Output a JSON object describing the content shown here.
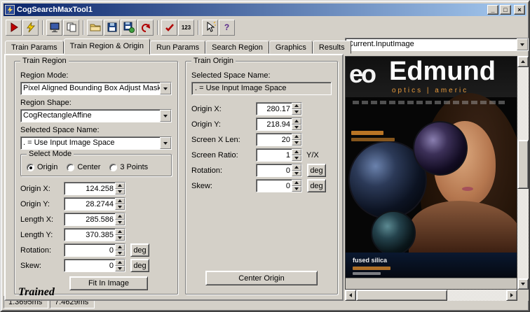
{
  "window": {
    "title": "CogSearchMaxTool1",
    "controls": {
      "minimize": "_",
      "maximize": "□",
      "close": "×"
    }
  },
  "toolbar": {
    "numeric_label": "123",
    "help_label": "?"
  },
  "tabs": [
    "Train Params",
    "Train Region & Origin",
    "Run Params",
    "Search Region",
    "Graphics",
    "Results"
  ],
  "active_tab": "Train Region & Origin",
  "image_selector": {
    "value": "Current.InputImage"
  },
  "train_region": {
    "title": "Train Region",
    "region_mode_label": "Region Mode:",
    "region_mode_value": "Pixel Aligned Bounding Box Adjust Mask",
    "region_shape_label": "Region Shape:",
    "region_shape_value": "CogRectangleAffine",
    "space_label": "Selected Space Name:",
    "space_value": ". = Use Input Image Space",
    "select_mode": {
      "title": "Select Mode",
      "options": [
        "Origin",
        "Center",
        "3 Points"
      ],
      "selected": "Origin"
    },
    "fields": [
      {
        "label": "Origin X:",
        "value": "124.258"
      },
      {
        "label": "Origin Y:",
        "value": "28.2744"
      },
      {
        "label": "Length X:",
        "value": "285.586"
      },
      {
        "label": "Length Y:",
        "value": "370.385"
      },
      {
        "label": "Rotation:",
        "value": "0",
        "unit": "deg"
      },
      {
        "label": "Skew:",
        "value": "0",
        "unit": "deg"
      }
    ],
    "fit_button": "Fit In Image"
  },
  "train_origin": {
    "title": "Train Origin",
    "space_label": "Selected Space Name:",
    "space_value": ". = Use Input Image Space",
    "fields": [
      {
        "label": "Origin X:",
        "value": "280.17"
      },
      {
        "label": "Origin Y:",
        "value": "218.94"
      },
      {
        "label": "Screen X Len:",
        "value": "20"
      },
      {
        "label": "Screen Ratio:",
        "value": "1",
        "unit": "Y/X"
      },
      {
        "label": "Rotation:",
        "value": "0",
        "unit": "deg"
      },
      {
        "label": "Skew:",
        "value": "0",
        "unit": "deg"
      }
    ],
    "center_button": "Center Origin"
  },
  "status": {
    "trained": "Trained",
    "time1": "1.3695ms",
    "time2": "7.4629ms"
  },
  "cover": {
    "logo": "eo",
    "title": "Edmund",
    "subtitle": "optics | americ",
    "caption": "fused silica"
  },
  "colors": {
    "titlebar_start": "#0a246a",
    "titlebar_end": "#a6caf0",
    "accent_orange": "#e89a3c",
    "chrome": "#d4d0c8"
  }
}
